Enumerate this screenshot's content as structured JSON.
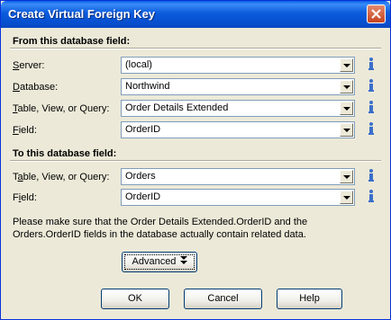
{
  "window": {
    "title": "Create Virtual Foreign Key"
  },
  "from_section": {
    "title": "From this database field:",
    "server": {
      "label_u": "S",
      "label_rest": "erver:",
      "value": "(local)"
    },
    "database": {
      "label_u": "D",
      "label_rest": "atabase:",
      "value": "Northwind"
    },
    "table": {
      "label_u": "T",
      "label_rest": "able, View, or Query:",
      "value": "Order Details Extended"
    },
    "field": {
      "label_u": "F",
      "label_rest": "ield:",
      "value": "OrderID"
    }
  },
  "to_section": {
    "title": "To this database field:",
    "table": {
      "label_pre": "T",
      "label_u": "a",
      "label_rest": "ble, View, or Query:",
      "value": "Orders"
    },
    "field": {
      "label_pre": "F",
      "label_u": "i",
      "label_rest": "eld:",
      "value": "OrderID"
    }
  },
  "note_line1": "Please make sure that the Order Details Extended.OrderID  and the",
  "note_line2": "Orders.OrderID fields in the database actually contain related data.",
  "buttons": {
    "advanced": "Advanced",
    "ok": "OK",
    "cancel": "Cancel",
    "help": "Help"
  },
  "icons": {
    "close": "close-icon",
    "info": "info-icon",
    "dropdown": "chevron-down-icon",
    "advanced": "double-chevron-down-icon"
  },
  "colors": {
    "titlebar": "#0A5FE6",
    "dialog_bg": "#ECE9D8",
    "input_border": "#7F9DB9",
    "info_blue": "#3B6FC9"
  }
}
